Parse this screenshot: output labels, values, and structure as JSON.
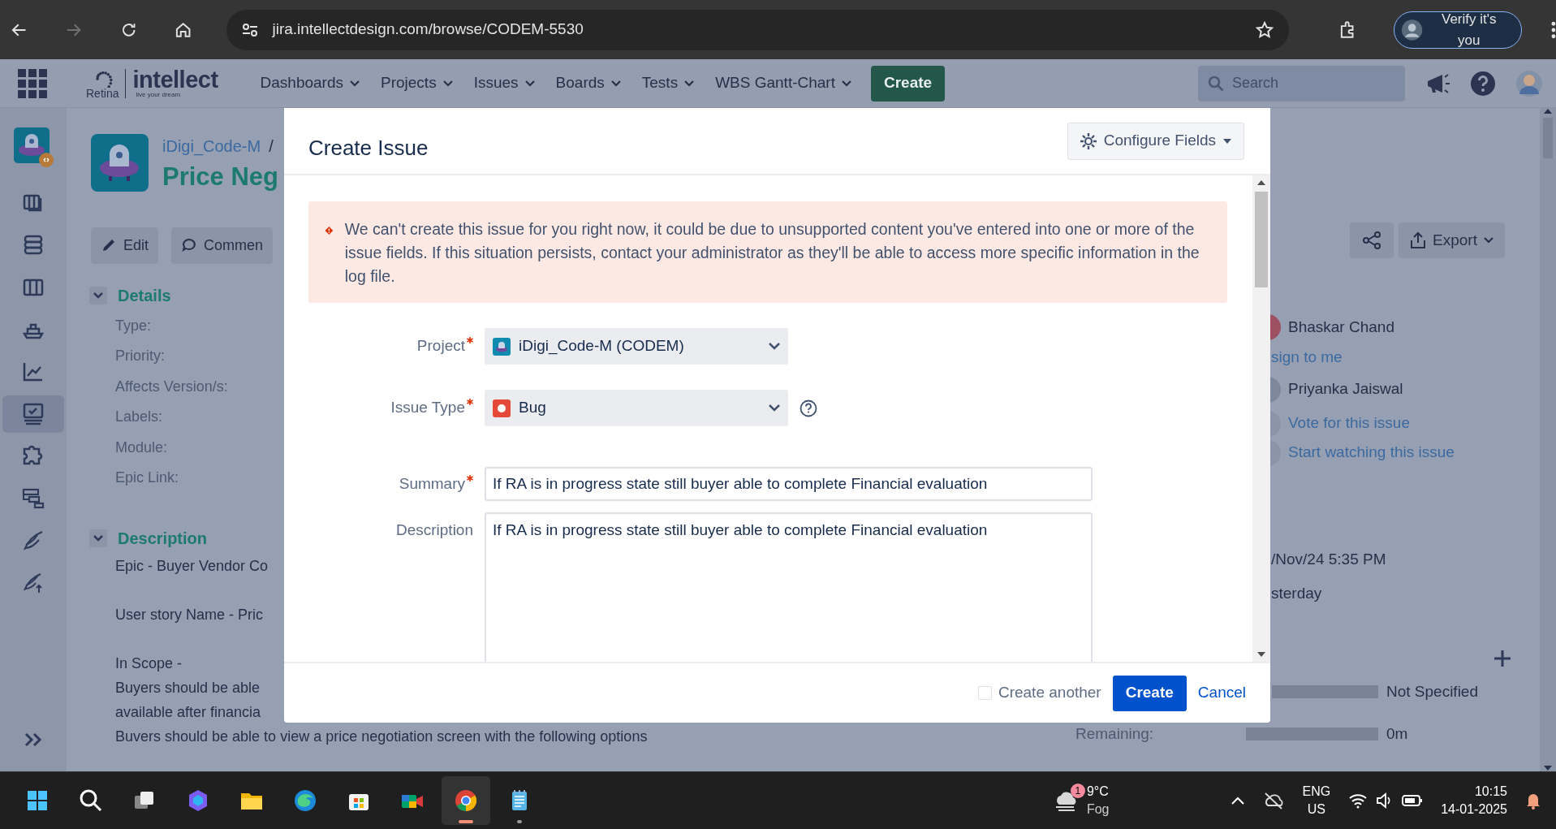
{
  "browser": {
    "url": "jira.intellectdesign.com/browse/CODEM-5530",
    "forward_disabled": true,
    "profile_button": "Verify it's you"
  },
  "app_header": {
    "logo_name": "Retina",
    "brand": "intellect",
    "tagline": "live your dream",
    "menus": [
      {
        "label": "Dashboards"
      },
      {
        "label": "Projects"
      },
      {
        "label": "Issues"
      },
      {
        "label": "Boards"
      },
      {
        "label": "Tests"
      },
      {
        "label": "WBS Gantt-Chart"
      }
    ],
    "create_button": "Create",
    "search": {
      "placeholder": "Search"
    }
  },
  "sidebar": {
    "items": [
      {
        "selected": false
      },
      {
        "selected": false
      },
      {
        "selected": false
      },
      {
        "selected": false
      },
      {
        "selected": false
      },
      {
        "selected": true
      },
      {
        "selected": false
      },
      {
        "selected": false
      },
      {
        "selected": false
      },
      {
        "selected": false
      }
    ]
  },
  "issue": {
    "project": "iDigi_Code-M",
    "separator": "/",
    "title": "Price Neg",
    "actions": [
      "Edit",
      "Commen"
    ],
    "export_button": "Export",
    "details": {
      "heading": "Details",
      "expanded": true,
      "labels": [
        "Type:",
        "Priority:",
        "Affects Version/s:",
        "Labels:",
        "Module:",
        "Epic Link:"
      ]
    },
    "description": {
      "heading": "Description",
      "expanded": true,
      "paragraphs": [
        [
          "Epic - Buyer Vendor Co"
        ],
        [
          "User story Name - Pric"
        ],
        [
          "In Scope -",
          "Buyers should be able",
          "available after financia",
          "Buvers should be able to view a price negotiation screen with the following options"
        ]
      ]
    },
    "people": {
      "assignee": "Bhaskar Chand",
      "assign_link": "sign to me",
      "reporter": "Priyanka Jaiswal",
      "vote_link": "Vote for this issue",
      "watch_link": "Start watching this issue"
    },
    "dates": [
      "/Nov/24 5:35 PM",
      "sterday"
    ],
    "time_tracking": {
      "estimated": {
        "level": 0,
        "reading": "Not Specified"
      },
      "remaining": {
        "label": "Remaining:",
        "level": 0,
        "reading": "0m"
      }
    }
  },
  "modal": {
    "title": "Create Issue",
    "configure_button": "Configure Fields",
    "error": "We can't create this issue for you right now, it could be due to unsupported content you've entered into one or more of the issue fields. If this situation persists, contact your administrator as they'll be able to access more specific information in the log file.",
    "field_groups": [
      [
        {
          "kind": "select",
          "label": "Project",
          "required": true,
          "value": "iDigi_Code-M (CODEM)",
          "help": false
        },
        {
          "kind": "select",
          "label": "Issue Type",
          "required": true,
          "value": "Bug",
          "help": true
        }
      ],
      [
        {
          "kind": "text",
          "label": "Summary",
          "required": true,
          "value": "If RA is in progress state still buyer able to complete Financial evaluation"
        },
        {
          "kind": "textarea",
          "label": "Description",
          "required": false,
          "value": "If RA is in progress state still buyer able to complete Financial evaluation"
        }
      ]
    ],
    "create_another": {
      "label": "Create another",
      "checked": false
    },
    "submit_button": "Create",
    "cancel_link": "Cancel"
  },
  "taskbar": {
    "apps": [
      {
        "active": false,
        "running": false
      },
      {
        "active": false,
        "running": false
      },
      {
        "active": false,
        "running": false
      },
      {
        "active": false,
        "running": false
      },
      {
        "active": false,
        "running": false
      },
      {
        "active": false,
        "running": false
      },
      {
        "active": false,
        "running": false
      },
      {
        "active": false,
        "running": false
      },
      {
        "active": true,
        "running": true
      },
      {
        "active": false,
        "running": true
      }
    ],
    "weather": {
      "badge": "1",
      "temperature": "9°C",
      "condition": "Fog"
    },
    "language": {
      "lang": "ENG",
      "region": "US"
    },
    "time": "10:15",
    "date": "14-01-2025"
  }
}
